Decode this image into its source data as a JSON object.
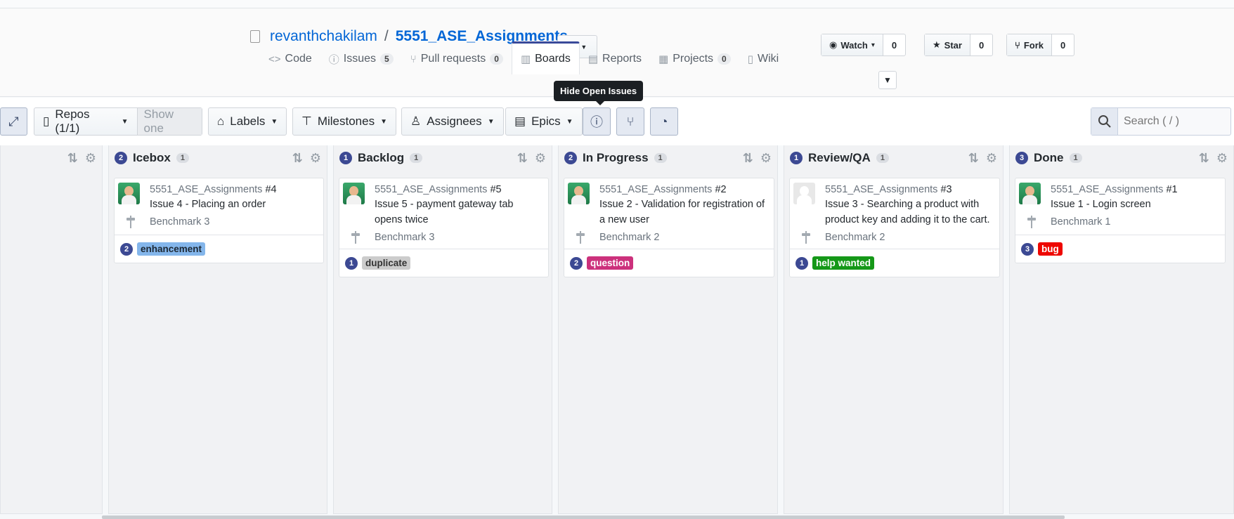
{
  "repo": {
    "owner": "revanthchakilam",
    "separator": "/",
    "name": "5551_ASE_Assignments"
  },
  "social": [
    {
      "icon": "eye-icon",
      "label": "Watch",
      "caret": "▾",
      "count": "0"
    },
    {
      "icon": "star-icon",
      "label": "Star",
      "count": "0"
    },
    {
      "icon": "fork-icon",
      "label": "Fork",
      "count": "0"
    }
  ],
  "tabs": [
    {
      "icon": "code-icon",
      "glyph": "<>",
      "label": "Code",
      "count": null
    },
    {
      "icon": "issue-icon",
      "glyph": "ⓘ",
      "label": "Issues",
      "count": "5"
    },
    {
      "icon": "pull-request-icon",
      "glyph": "⑂",
      "label": "Pull requests",
      "count": "0"
    },
    {
      "icon": "boards-icon",
      "glyph": "▥",
      "label": "Boards",
      "count": null
    },
    {
      "icon": "reports-icon",
      "glyph": "▤",
      "label": "Reports",
      "count": null
    },
    {
      "icon": "projects-icon",
      "glyph": "▦",
      "label": "Projects",
      "count": "0"
    },
    {
      "icon": "wiki-icon",
      "glyph": "▯",
      "label": "Wiki",
      "count": null
    }
  ],
  "tooltip": "Hide Open Issues",
  "toolbar": {
    "repos_label": "Repos (1/1)",
    "show_one": "Show one",
    "labels_label": "Labels",
    "milestones_label": "Milestones",
    "assignees_label": "Assignees",
    "epics_label": "Epics",
    "search_placeholder": "Search ( / )"
  },
  "columns": [
    {
      "name": "",
      "number": "",
      "count": ""
    },
    {
      "name": "Icebox",
      "number": "2",
      "count": "1"
    },
    {
      "name": "Backlog",
      "number": "1",
      "count": "1"
    },
    {
      "name": "In Progress",
      "number": "2",
      "count": "1"
    },
    {
      "name": "Review/QA",
      "number": "1",
      "count": "1"
    },
    {
      "name": "Done",
      "number": "3",
      "count": "1"
    }
  ],
  "cards": [
    {
      "repo": "5551_ASE_Assignments",
      "issue": "#4",
      "title": "Issue 4 - Placing an order",
      "milestone": "Benchmark 3",
      "label_num": "2",
      "label": "enhancement",
      "label_bg": "#84b6eb",
      "label_fg": "#1c2733",
      "avatar": "photo"
    },
    {
      "repo": "5551_ASE_Assignments",
      "issue": "#5",
      "title": "Issue 5 - payment gateway tab opens twice",
      "milestone": "Benchmark 3",
      "label_num": "1",
      "label": "duplicate",
      "label_bg": "#cccccc",
      "label_fg": "#333333",
      "avatar": "photo"
    },
    {
      "repo": "5551_ASE_Assignments",
      "issue": "#2",
      "title": "Issue 2 - Validation for registration of a new user",
      "milestone": "Benchmark 2",
      "label_num": "2",
      "label": "question",
      "label_bg": "#cc317c",
      "label_fg": "#ffffff",
      "avatar": "photo"
    },
    {
      "repo": "5551_ASE_Assignments",
      "issue": "#3",
      "title": "Issue 3 - Searching a product with product key and adding it to the cart.",
      "milestone": "Benchmark 2",
      "label_num": "1",
      "label": "help wanted",
      "label_bg": "#159818",
      "label_fg": "#ffffff",
      "avatar": "blank"
    },
    {
      "repo": "5551_ASE_Assignments",
      "issue": "#1",
      "title": "Issue 1 - Login screen",
      "milestone": "Benchmark 1",
      "label_num": "3",
      "label": "bug",
      "label_bg": "#ee0701",
      "label_fg": "#ffffff",
      "avatar": "photo"
    }
  ]
}
